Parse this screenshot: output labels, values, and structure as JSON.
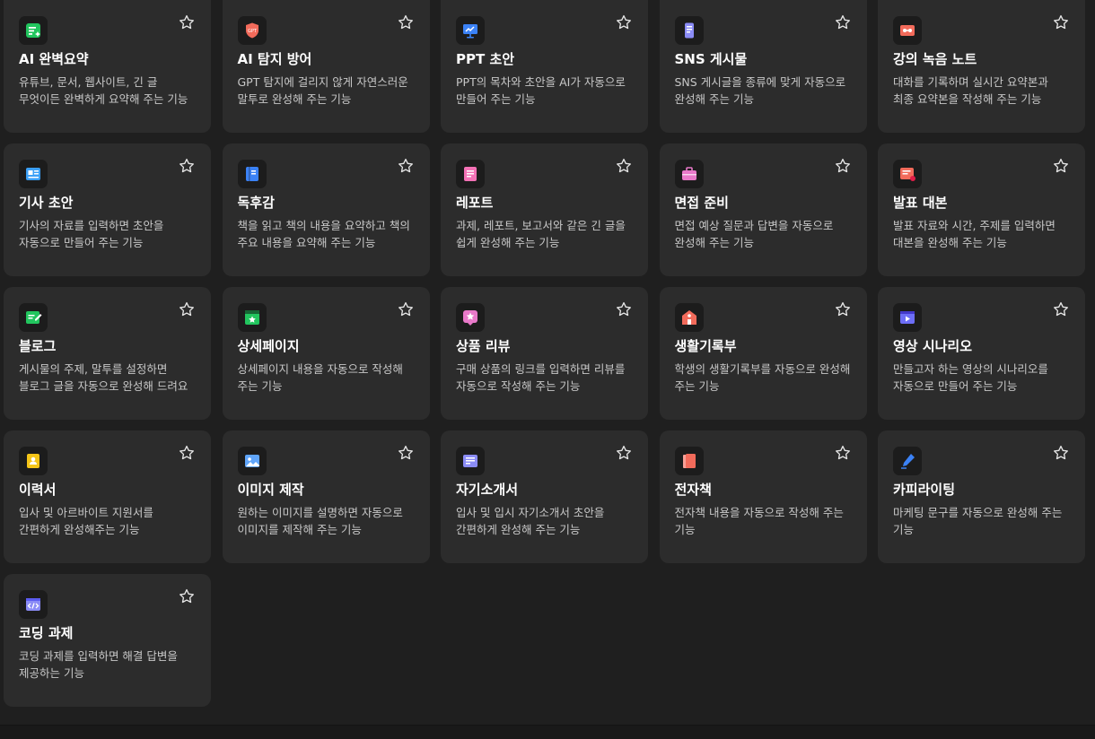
{
  "cards": [
    {
      "key": "summary",
      "title": "AI 완벽요약",
      "desc": "유튜브, 문서, 웹사이트, 긴 글 무엇이든 완벽하게 요약해 주는 기능",
      "icon": "summary-icon",
      "color": "#22c55e"
    },
    {
      "key": "detect",
      "title": "AI 탐지 방어",
      "desc": "GPT 탐지에 걸리지 않게 자연스러운 말투로 완성해 주는 기능",
      "icon": "gpt-shield-icon",
      "color": "#f26b5b"
    },
    {
      "key": "ppt",
      "title": "PPT 초안",
      "desc": "PPT의 목차와 초안을 AI가 자동으로 만들어 주는 기능",
      "icon": "presentation-icon",
      "color": "#3b82f6"
    },
    {
      "key": "sns",
      "title": "SNS 게시물",
      "desc": "SNS 게시글을 종류에 맞게 자동으로 완성해 주는 기능",
      "icon": "phone-icon",
      "color": "#8b8cf6"
    },
    {
      "key": "lecture",
      "title": "강의 녹음 노트",
      "desc": "대화를 기록하며 실시간 요약본과 최종 요약본을 작성해 주는 기능",
      "icon": "cassette-icon",
      "color": "#f26b5b"
    },
    {
      "key": "article",
      "title": "기사 초안",
      "desc": "기사의 자료를 입력하면 초안을 자동으로 만들어 주는 기능",
      "icon": "newspaper-icon",
      "color": "#3b9ff6"
    },
    {
      "key": "book",
      "title": "독후감",
      "desc": "책을 읽고 책의 내용을 요약하고 책의 주요 내용을 요약해 주는 기능",
      "icon": "book-icon",
      "color": "#3b82f6"
    },
    {
      "key": "report",
      "title": "레포트",
      "desc": "과제, 레포트, 보고서와 같은 긴 글을 쉽게 완성해 주는 기능",
      "icon": "report-icon",
      "color": "#f472b6"
    },
    {
      "key": "interview",
      "title": "면접 준비",
      "desc": "면접 예상 질문과 답변을 자동으로 완성해 주는 기능",
      "icon": "briefcase-icon",
      "color": "#e879c9"
    },
    {
      "key": "speech",
      "title": "발표 대본",
      "desc": "발표 자료와 시간, 주제를 입력하면 대본을 완성해 주는 기능",
      "icon": "script-icon",
      "color": "#f26b5b"
    },
    {
      "key": "blog",
      "title": "블로그",
      "desc": "게시물의 주제, 말투를 설정하면 블로그 글을 자동으로 완성해 드려요",
      "icon": "blog-edit-icon",
      "color": "#22c55e"
    },
    {
      "key": "detail",
      "title": "상세페이지",
      "desc": "상세페이지 내용을 자동으로 작성해 주는 기능",
      "icon": "detail-page-icon",
      "color": "#22c55e"
    },
    {
      "key": "review",
      "title": "상품 리뷰",
      "desc": "구매 상품의 링크를 입력하면 리뷰를 자동으로 작성해 주는 기능",
      "icon": "review-star-icon",
      "color": "#e879c9"
    },
    {
      "key": "record",
      "title": "생활기록부",
      "desc": "학생의 생활기록부를 자동으로 완성해 주는 기능",
      "icon": "school-icon",
      "color": "#f26b5b"
    },
    {
      "key": "video",
      "title": "영상 시나리오",
      "desc": "만들고자 하는 영상의 시나리오를 자동으로 만들어 주는 기능",
      "icon": "video-icon",
      "color": "#6d6ef6"
    },
    {
      "key": "resume",
      "title": "이력서",
      "desc": "입사 및 아르바이트 지원서를 간편하게 완성해주는 기능",
      "icon": "resume-icon",
      "color": "#f5c518"
    },
    {
      "key": "image",
      "title": "이미지 제작",
      "desc": "원하는 이미지를 설명하면 자동으로 이미지를 제작해 주는 기능",
      "icon": "image-icon",
      "color": "#60a5fa"
    },
    {
      "key": "intro",
      "title": "자기소개서",
      "desc": "입사 및 입시 자기소개서 초안을 간편하게 완성해 주는 기능",
      "icon": "intro-doc-icon",
      "color": "#8b8cf6"
    },
    {
      "key": "ebook",
      "title": "전자책",
      "desc": "전자책 내용을 자동으로 작성해 주는 기능",
      "icon": "ebook-icon",
      "color": "#f26b5b"
    },
    {
      "key": "copy",
      "title": "카피라이팅",
      "desc": "마케팅 문구를 자동으로 완성해 주는 기능",
      "icon": "pen-icon",
      "color": "#3b82f6"
    },
    {
      "key": "coding",
      "title": "코딩 과제",
      "desc": "코딩 과제를 입력하면 해결 답변을 제공하는 기능",
      "icon": "code-icon",
      "color": "#8b8cf6"
    }
  ]
}
